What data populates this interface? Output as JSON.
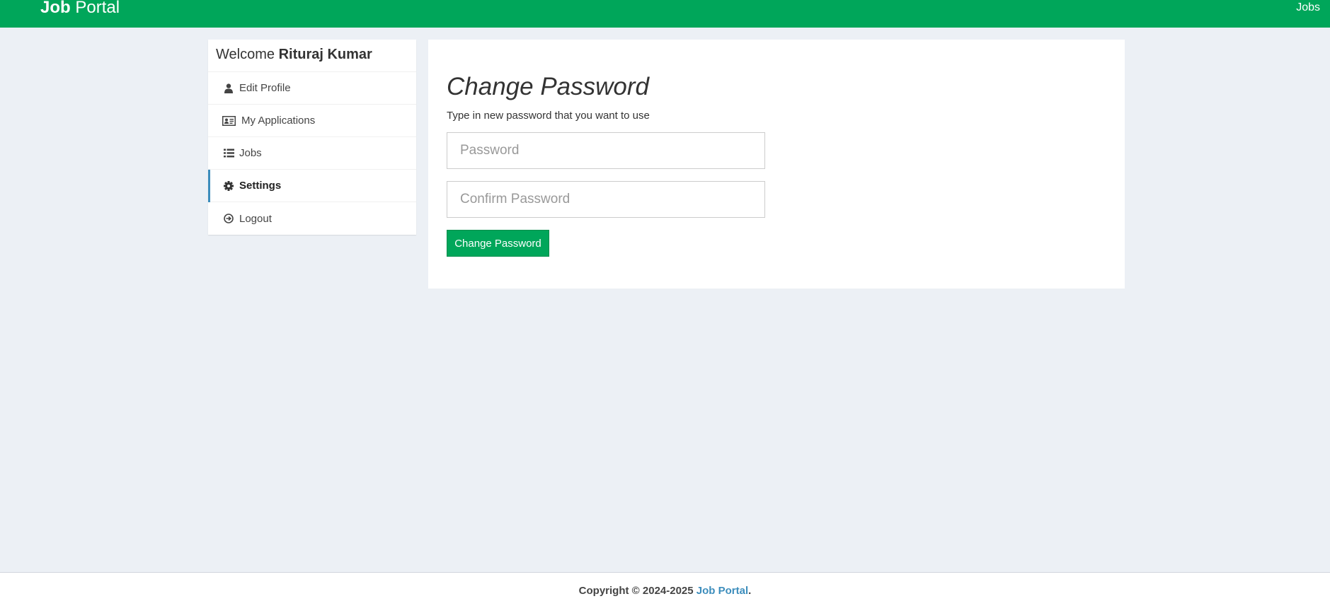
{
  "navbar": {
    "brand_bold": "Job",
    "brand_light": "Portal",
    "nav_link": "Jobs",
    "color": "#00a65a"
  },
  "sidebar": {
    "welcome_prefix": "Welcome",
    "user_name": "Rituraj Kumar",
    "items": [
      {
        "label": "Edit Profile",
        "icon": "user-icon"
      },
      {
        "label": "My Applications",
        "icon": "id-card-icon"
      },
      {
        "label": "Jobs",
        "icon": "list-icon"
      },
      {
        "label": "Settings",
        "icon": "gear-icon",
        "active": true
      },
      {
        "label": "Logout",
        "icon": "logout-icon"
      }
    ]
  },
  "main": {
    "title": "Change Password",
    "subtitle": "Type in new password that you want to use",
    "password_placeholder": "Password",
    "confirm_placeholder": "Confirm Password",
    "submit_label": "Change Password"
  },
  "footer": {
    "copyright": "Copyright © 2024-2025",
    "link": "Job Portal",
    "suffix": "."
  }
}
